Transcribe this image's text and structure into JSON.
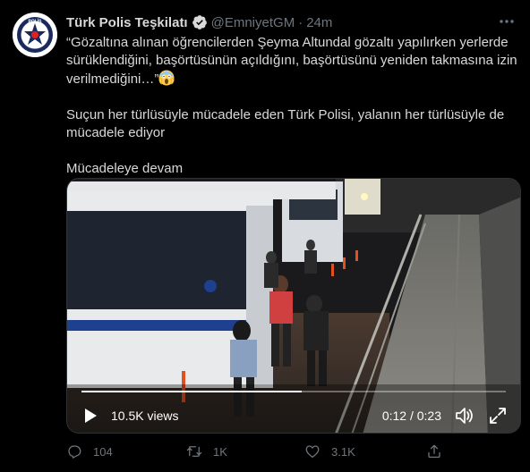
{
  "author": {
    "name": "Türk Polis Teşkilatı",
    "handle": "@EmniyetGM",
    "separator": "·",
    "time": "24m",
    "avatar_text": "POLİS"
  },
  "tweet": {
    "paragraphs": [
      "“Gözaltına alınan öğrencilerden Şeyma Altundal gözaltı yapılırken yerlerde sürüklendiğini, başörtüsünün açıldığını, başörtüsünü yeniden takmasına izin verilmediğini…”",
      "Suçun her türlüsüyle mücadele eden Türk Polisi, yalanın her türlüsüyle de mücadele ediyor",
      "Mücadeleye devam"
    ],
    "emoji": "screaming-face-emoji"
  },
  "video": {
    "views": "10.5K views",
    "timecode": "0:12 / 0:23",
    "progress": 0.52
  },
  "actions": {
    "replies": "104",
    "retweets": "1K",
    "likes": "3.1K"
  },
  "icons": {
    "more": "more-icon",
    "verified": "verified-badge-icon",
    "play": "play-icon",
    "volume": "volume-icon",
    "expand": "expand-icon",
    "reply": "reply-icon",
    "retweet": "retweet-icon",
    "like": "like-icon",
    "share": "share-icon"
  },
  "colors": {
    "background": "#000000",
    "text": "#d9d9d9",
    "muted": "#6e767d",
    "verified": "#d9d9d9",
    "avatar_badge": "#1a2a5e"
  }
}
